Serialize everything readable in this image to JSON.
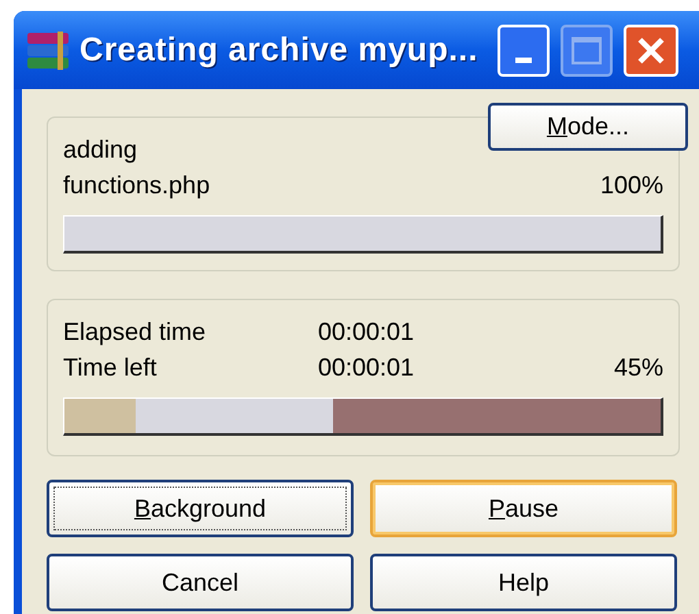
{
  "window": {
    "title": "Creating archive myup..."
  },
  "file_progress": {
    "mode_button": {
      "label": "Mode...",
      "underline_first": true
    },
    "action": "adding",
    "file": "functions.php",
    "percent": "100%",
    "level": 1
  },
  "overall_progress": {
    "rows": [
      {
        "label": "Elapsed time",
        "value": "00:00:01"
      },
      {
        "label": "Time left",
        "value": "00:00:01"
      }
    ],
    "percent": "45%",
    "segments": [
      {
        "level": 0.12
      },
      {
        "level": 0.45
      }
    ]
  },
  "buttons": [
    {
      "label": "Background",
      "underline_first": true,
      "focused": true,
      "default": false
    },
    {
      "label": "Pause",
      "underline_first": true,
      "focused": false,
      "default": true
    },
    {
      "label": "Cancel",
      "underline_first": false,
      "focused": false,
      "default": false
    },
    {
      "label": "Help",
      "underline_first": false,
      "focused": false,
      "default": false
    }
  ]
}
